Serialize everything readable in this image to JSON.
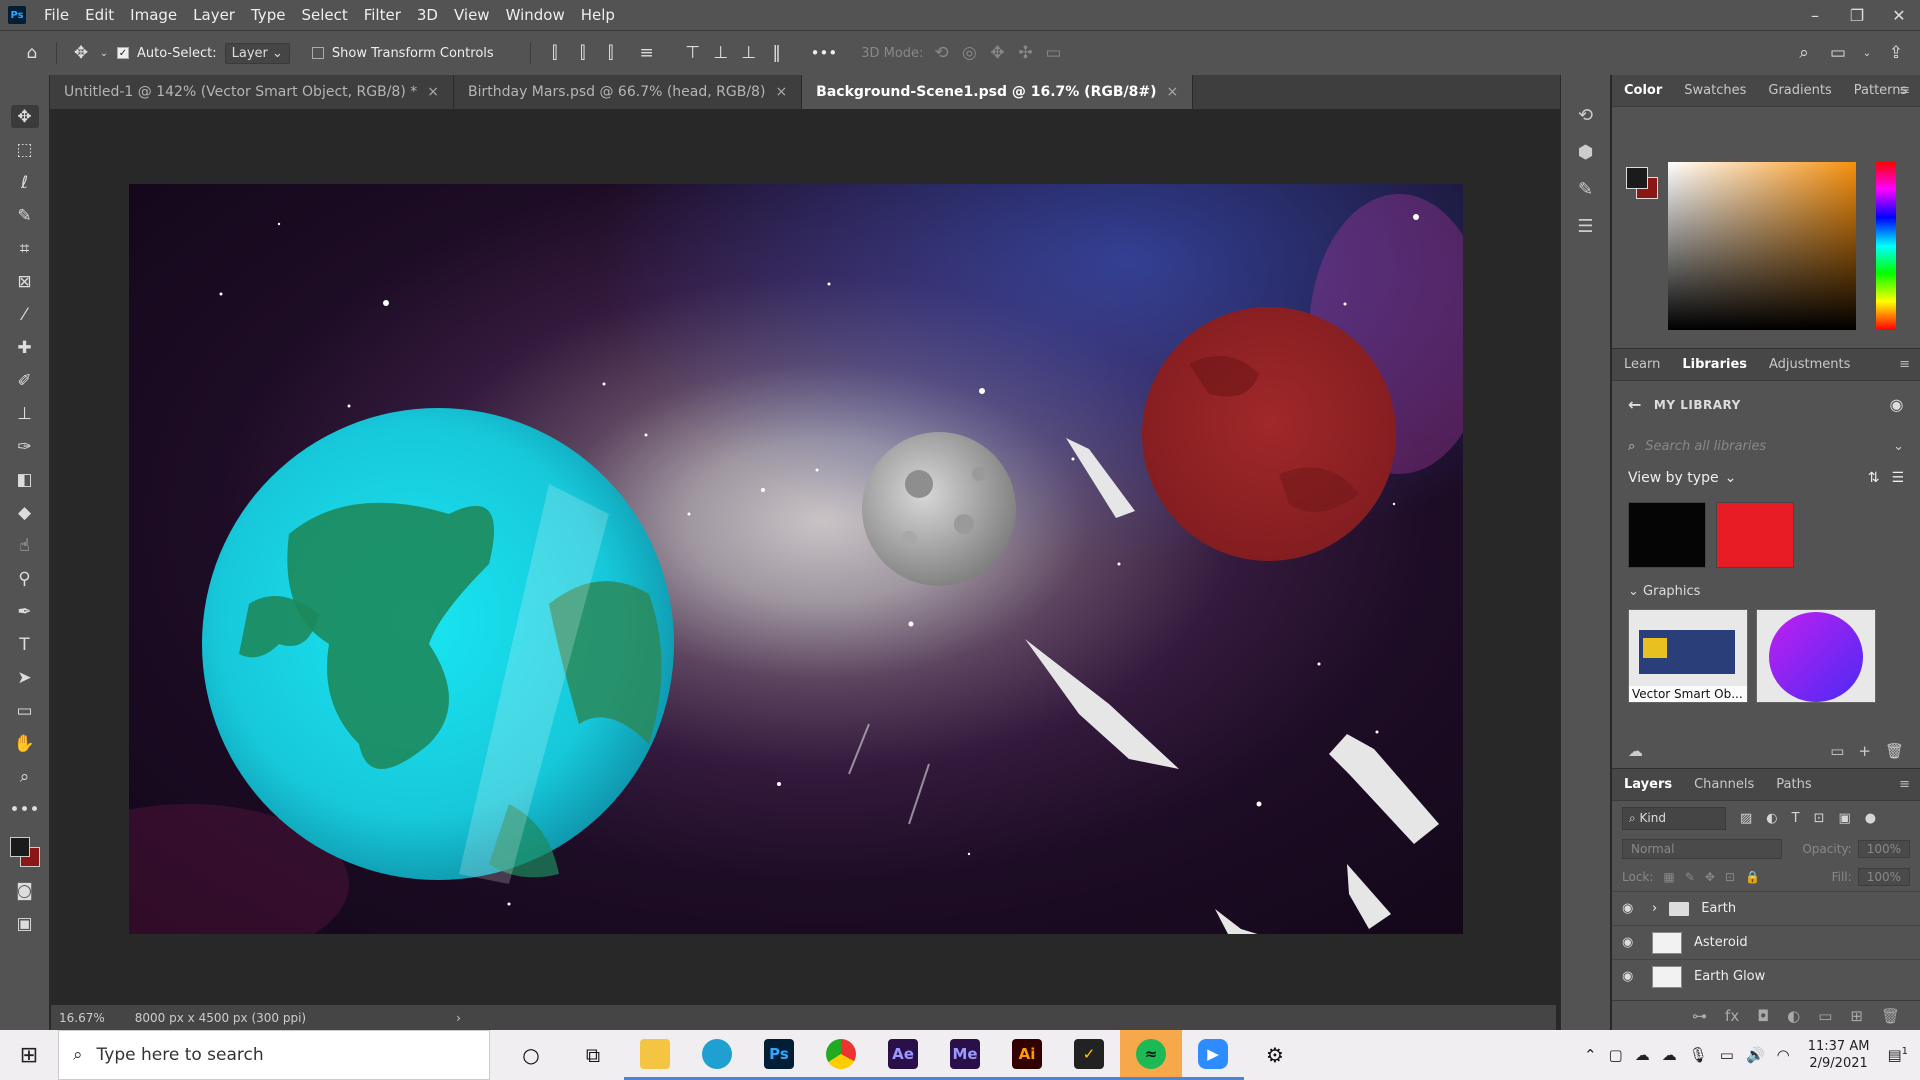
{
  "menubar": {
    "logo": "Ps",
    "items": [
      "File",
      "Edit",
      "Image",
      "Layer",
      "Type",
      "Select",
      "Filter",
      "3D",
      "View",
      "Window",
      "Help"
    ],
    "window_controls": [
      "–",
      "❐",
      "✕"
    ]
  },
  "options_bar": {
    "auto_select_label": "Auto-Select:",
    "auto_select_target": "Layer",
    "show_transform_label": "Show Transform Controls",
    "more_label": "•••",
    "mode_3d_label": "3D Mode:"
  },
  "tabs": [
    {
      "label": "Untitled-1 @ 142% (Vector Smart Object, RGB/8) *",
      "close": "×"
    },
    {
      "label": "Birthday Mars.psd @ 66.7% (head, RGB/8)",
      "close": "×"
    },
    {
      "label": "Background-Scene1.psd @ 16.7% (RGB/8#)",
      "close": "×"
    }
  ],
  "status_bar": {
    "zoom": "16.67%",
    "doc_info": "8000 px x 4500 px (300 ppi)",
    "arrow": "›"
  },
  "color_panel": {
    "tabs": [
      "Color",
      "Swatches",
      "Gradients",
      "Patterns"
    ],
    "foreground": "#1b1b1b",
    "background": "#8a1616"
  },
  "library_panel": {
    "tabs": [
      "Learn",
      "Libraries",
      "Adjustments"
    ],
    "title": "MY LIBRARY",
    "search_placeholder": "Search all libraries",
    "view_by": "View by type",
    "colors": [
      "#050505",
      "#e81c24"
    ],
    "graphics_title": "Graphics",
    "graphics": [
      {
        "caption": "Vector Smart Ob..."
      },
      {
        "caption": ""
      }
    ]
  },
  "layers_panel": {
    "tabs": [
      "Layers",
      "Channels",
      "Paths"
    ],
    "filter_kind": "Kind",
    "blend_mode": "Normal",
    "opacity_label": "Opacity:",
    "opacity_value": "100%",
    "lock_label": "Lock:",
    "fill_label": "Fill:",
    "fill_value": "100%",
    "layers": [
      {
        "name": "Earth",
        "type": "group"
      },
      {
        "name": "Asteroid",
        "type": "layer"
      },
      {
        "name": "Earth Glow",
        "type": "layer"
      }
    ]
  },
  "taskbar": {
    "search_placeholder": "Type here to search",
    "apps": [
      {
        "label": "Ae",
        "color": "#2a0f48",
        "text": "#9999ff"
      },
      {
        "label": "Me",
        "color": "#2a0f48",
        "text": "#9999ff"
      },
      {
        "label": "Ai",
        "color": "#330000",
        "text": "#ff9a00"
      }
    ],
    "ps_label": "Ps",
    "time": "11:37 AM",
    "date": "2/9/2021",
    "notification_count": "1"
  }
}
